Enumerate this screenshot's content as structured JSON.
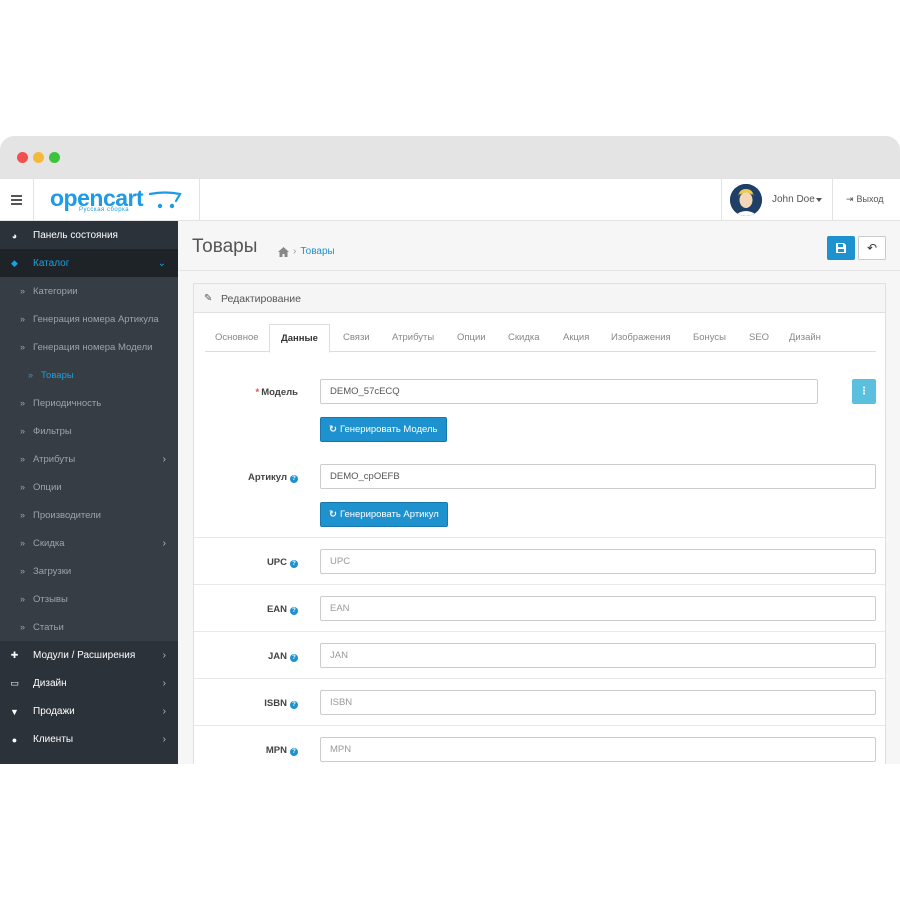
{
  "header": {
    "logo_text": "opencart",
    "logo_subtitle": "Русская сборка",
    "user_name": "John Doe",
    "logout_label": "Выход"
  },
  "sidebar": {
    "items": [
      {
        "label": "Панель состояния",
        "icon": "dashboard-icon"
      },
      {
        "label": "Каталог",
        "icon": "tag-icon",
        "active": true
      },
      {
        "label": "Модули / Расширения",
        "icon": "puzzle-icon"
      },
      {
        "label": "Дизайн",
        "icon": "monitor-icon"
      },
      {
        "label": "Продажи",
        "icon": "cart-icon"
      },
      {
        "label": "Клиенты",
        "icon": "user-icon"
      }
    ],
    "catalog_sub": [
      "Категории",
      "Генерация номера Артикула",
      "Генерация номера Модели",
      "Товары",
      "Периодичность",
      "Фильтры",
      "Атрибуты",
      "Опции",
      "Производители",
      "Скидка",
      "Загрузки",
      "Отзывы",
      "Статьи"
    ]
  },
  "page": {
    "title": "Товары",
    "breadcrumb": "Товары",
    "panel_title": "Редактирование"
  },
  "tabs": [
    "Основное",
    "Данные",
    "Связи",
    "Атрибуты",
    "Опции",
    "Скидка",
    "Акция",
    "Изображения",
    "Бонусы",
    "SEO",
    "Дизайн"
  ],
  "active_tab": "Данные",
  "form": {
    "model_label": "Модель",
    "model_value": "DEMO_57cECQ",
    "gen_model_label": "Генерировать Модель",
    "sku_label": "Артикул",
    "sku_value": "DEMO_cpOEFB",
    "gen_sku_label": "Генерировать Артикул",
    "upc_label": "UPC",
    "upc_placeholder": "UPC",
    "ean_label": "EAN",
    "ean_placeholder": "EAN",
    "jan_label": "JAN",
    "jan_placeholder": "JAN",
    "isbn_label": "ISBN",
    "isbn_placeholder": "ISBN",
    "mpn_label": "MPN",
    "mpn_placeholder": "MPN"
  },
  "colors": {
    "accent": "#1e91cf",
    "sidebar_bg": "#2c323a",
    "sidebar_active": "#1ca0df",
    "info_button": "#5bc0de"
  }
}
